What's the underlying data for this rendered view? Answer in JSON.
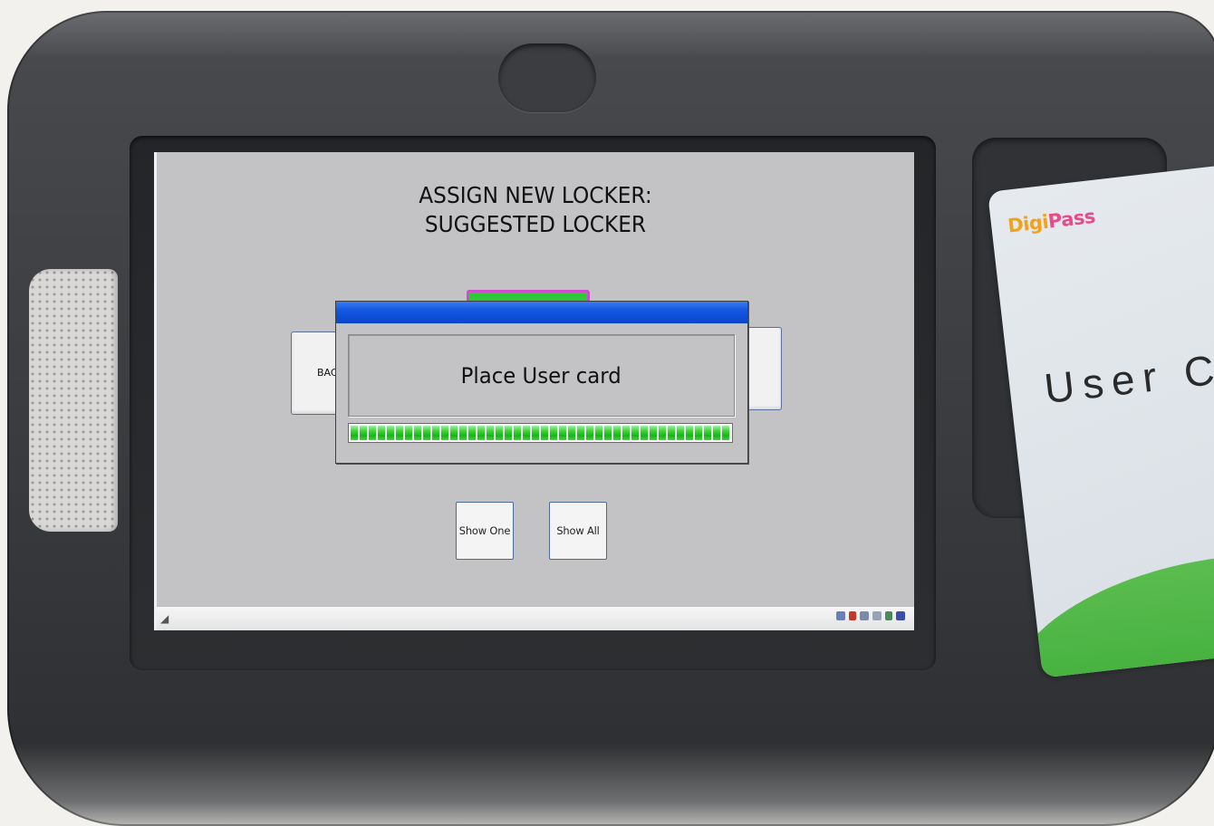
{
  "screen": {
    "title_line1": "ASSIGN NEW LOCKER:",
    "title_line2": "SUGGESTED LOCKER",
    "back_label": "BAC",
    "show_one_label": "Show One",
    "show_all_label": "Show All"
  },
  "dialog": {
    "message": "Place User card",
    "progress_percent": 100
  },
  "card": {
    "brand_part1": "Digi",
    "brand_part2": "Pass",
    "label": "User Ca"
  },
  "colors": {
    "dialog_titlebar": "#1457e0",
    "progress_fill": "#2ec32b",
    "screen_bg": "#c3c2c5",
    "card_wave": "#3fae3a"
  }
}
